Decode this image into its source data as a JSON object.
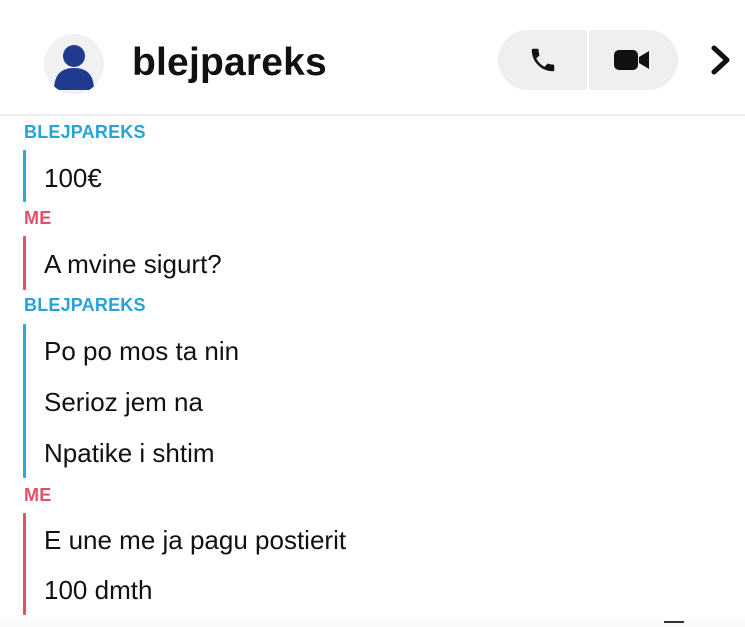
{
  "header": {
    "contact_name": "blejpareks",
    "avatar_icon": "user-silhouette-icon",
    "call_icon": "phone-icon",
    "video_icon": "video-camera-icon",
    "more_icon": "chevron-right-icon"
  },
  "colors": {
    "them": "#27a3d6",
    "me": "#e2506a"
  },
  "conversation": [
    {
      "sender": "BLEJPAREKS",
      "side": "them",
      "messages": [
        "100€"
      ]
    },
    {
      "sender": "ME",
      "side": "me",
      "messages": [
        "A mvine sigurt?"
      ]
    },
    {
      "sender": "BLEJPAREKS",
      "side": "them",
      "messages": [
        "Po po mos ta nin",
        "Serioz jem na",
        "Npatike i shtim"
      ]
    },
    {
      "sender": "ME",
      "side": "me",
      "messages": [
        "E une me ja pagu postierit",
        "100 dmth"
      ]
    }
  ]
}
